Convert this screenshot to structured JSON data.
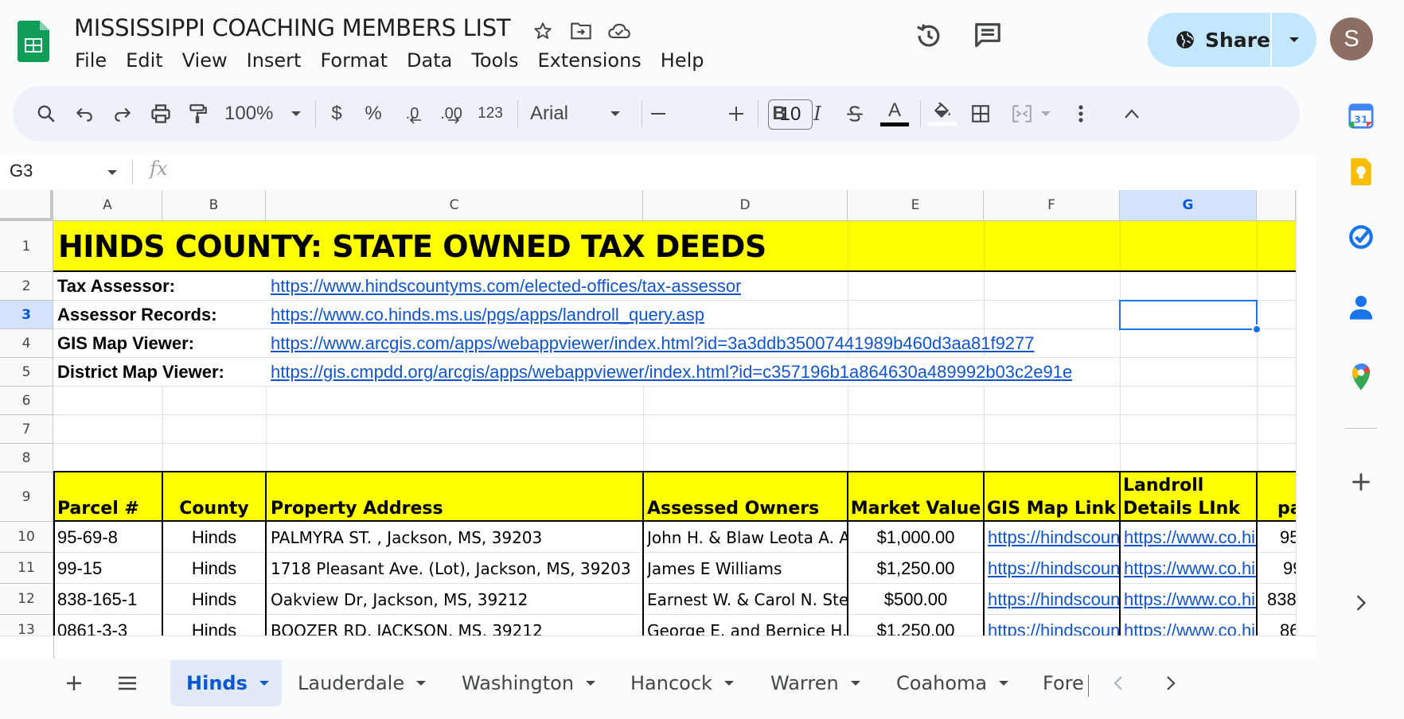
{
  "doc": {
    "title": "MISSISSIPPI COACHING MEMBERS LIST"
  },
  "menu": [
    "File",
    "Edit",
    "View",
    "Insert",
    "Format",
    "Data",
    "Tools",
    "Extensions",
    "Help"
  ],
  "header": {
    "share_label": "Share",
    "avatar_letter": "S"
  },
  "toolbar": {
    "zoom": "100%",
    "currency": "$",
    "percent": "%",
    "dec_decrease": ".0",
    "dec_increase": ".00",
    "number_format": "123",
    "font": "Arial",
    "font_size": "10",
    "bold": "B",
    "italic": "I",
    "text_color": "A"
  },
  "formula_bar": {
    "name_box": "G3",
    "fx": "fx",
    "value": ""
  },
  "columns": [
    "A",
    "B",
    "C",
    "D",
    "E",
    "F",
    "G"
  ],
  "rows": [
    "1",
    "2",
    "3",
    "4",
    "5",
    "6",
    "7",
    "8",
    "9",
    "10",
    "11",
    "12",
    "13"
  ],
  "sheet": {
    "title": "HINDS COUNTY: STATE OWNED TAX DEEDS",
    "links": [
      {
        "label": "Tax Assessor:",
        "url": "https://www.hindscountyms.com/elected-offices/tax-assessor"
      },
      {
        "label": "Assessor Records:",
        "url": "https://www.co.hinds.ms.us/pgs/apps/landroll_query.asp"
      },
      {
        "label": "GIS Map Viewer:",
        "url": "https://www.arcgis.com/apps/webappviewer/index.html?id=3a3ddb35007441989b460d3aa81f9277"
      },
      {
        "label": "District Map Viewer:",
        "url": "https://gis.cmpdd.org/arcgis/apps/webappviewer/index.html?id=c357196b1a864630a489992b03c2e91e"
      }
    ],
    "table_headers": [
      "Parcel #",
      "County",
      "Property Address",
      "Assessed Owners",
      "Market Value",
      "GIS Map Link",
      "Landroll",
      "Details LInk",
      "pa"
    ],
    "table_rows": [
      {
        "parcel": "95-69-8",
        "county": "Hinds",
        "address": "PALMYRA ST. , Jackson, MS, 39203",
        "owners": "John H. & Blaw Leota A. A",
        "value": "$1,000.00",
        "gis": "https://hindscounty",
        "details": "https://www.co.hinds",
        "extra": "95"
      },
      {
        "parcel": "99-15",
        "county": "Hinds",
        "address": "1718 Pleasant Ave. (Lot), Jackson, MS, 39203",
        "owners": "James E Williams",
        "value": "$1,250.00",
        "gis": "https://hindscounty",
        "details": "https://www.co.hinds",
        "extra": "99"
      },
      {
        "parcel": "838-165-1",
        "county": "Hinds",
        "address": "Oakview Dr, Jackson, MS, 39212",
        "owners": "Earnest W. & Carol N. Ste",
        "value": "$500.00",
        "gis": "https://hindscounty",
        "details": "https://www.co.hinds",
        "extra": "838"
      },
      {
        "parcel": "0861-3-3",
        "county": "Hinds",
        "address": "BOOZER RD, JACKSON, MS, 39212",
        "owners": "George E. and Bernice H.",
        "value": "$1,250.00",
        "gis": "https://hindscounty",
        "details": "https://www.co.hinds",
        "extra": "86"
      }
    ]
  },
  "tabs": [
    {
      "label": "Hinds",
      "active": true
    },
    {
      "label": "Lauderdale"
    },
    {
      "label": "Washington"
    },
    {
      "label": "Hancock"
    },
    {
      "label": "Warren"
    },
    {
      "label": "Coahoma"
    },
    {
      "label": "Fore"
    }
  ],
  "colors": {
    "accent": "#0b57d0",
    "highlight": "#ffff00",
    "link": "#1155cc",
    "share_bg": "#c2e7ff"
  }
}
